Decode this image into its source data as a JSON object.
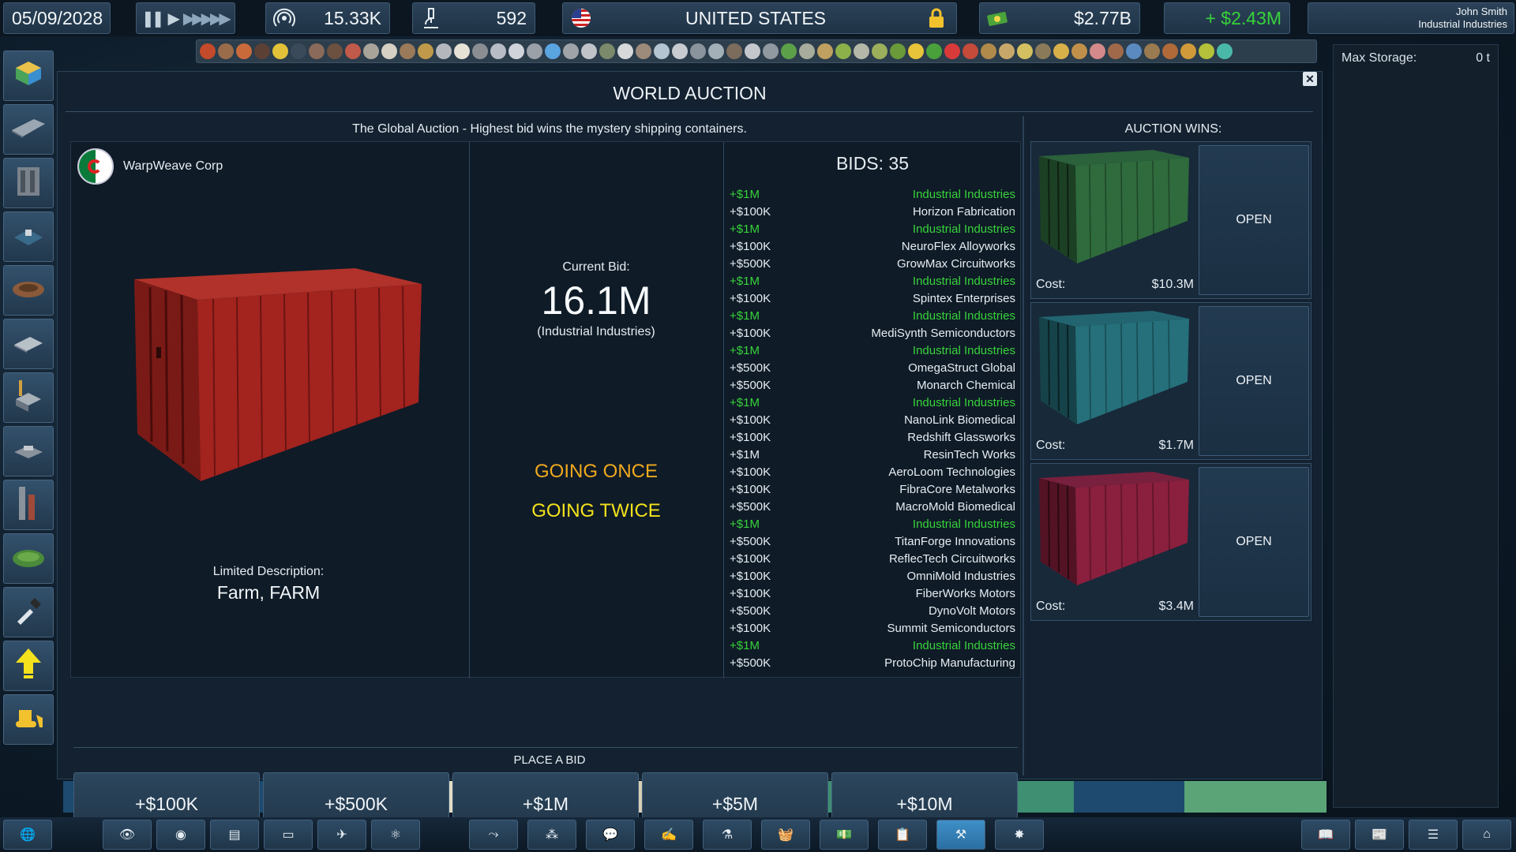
{
  "topbar": {
    "date": "05/09/2028",
    "speed_label": "game-speed-controls",
    "influence": "15.33K",
    "research": "592",
    "country": "UNITED STATES",
    "cash": "$2.77B",
    "income": "+ $2.43M",
    "user_name": "John Smith",
    "user_company": "Industrial Industries"
  },
  "right_panel": {
    "max_storage_label": "Max Storage:",
    "max_storage_value": "0 t"
  },
  "auction": {
    "title": "WORLD AUCTION",
    "subtitle": "The Global Auction - Highest bid wins the mystery shipping containers.",
    "company": "WarpWeave Corp",
    "desc_label": "Limited Description:",
    "desc_value": "Farm, FARM",
    "current_bid_label": "Current Bid:",
    "current_bid_value": "16.1M",
    "current_bidder": "(Industrial Industries)",
    "going_once": "GOING ONCE",
    "going_twice": "GOING TWICE",
    "bids_title": "BIDS:  35",
    "bids": [
      {
        "amount": "+$1M",
        "bidder": "Industrial Industries",
        "own": true
      },
      {
        "amount": "+$100K",
        "bidder": "Horizon Fabrication",
        "own": false
      },
      {
        "amount": "+$1M",
        "bidder": "Industrial Industries",
        "own": true
      },
      {
        "amount": "+$100K",
        "bidder": "NeuroFlex Alloyworks",
        "own": false
      },
      {
        "amount": "+$500K",
        "bidder": "GrowMax Circuitworks",
        "own": false
      },
      {
        "amount": "+$1M",
        "bidder": "Industrial Industries",
        "own": true
      },
      {
        "amount": "+$100K",
        "bidder": "Spintex Enterprises",
        "own": false
      },
      {
        "amount": "+$1M",
        "bidder": "Industrial Industries",
        "own": true
      },
      {
        "amount": "+$100K",
        "bidder": "MediSynth Semiconductors",
        "own": false
      },
      {
        "amount": "+$1M",
        "bidder": "Industrial Industries",
        "own": true
      },
      {
        "amount": "+$500K",
        "bidder": "OmegaStruct Global",
        "own": false
      },
      {
        "amount": "+$500K",
        "bidder": "Monarch Chemical",
        "own": false
      },
      {
        "amount": "+$1M",
        "bidder": "Industrial Industries",
        "own": true
      },
      {
        "amount": "+$100K",
        "bidder": "NanoLink Biomedical",
        "own": false
      },
      {
        "amount": "+$100K",
        "bidder": "Redshift Glassworks",
        "own": false
      },
      {
        "amount": "+$1M",
        "bidder": "ResinTech Works",
        "own": false
      },
      {
        "amount": "+$100K",
        "bidder": "AeroLoom Technologies",
        "own": false
      },
      {
        "amount": "+$100K",
        "bidder": "FibraCore Metalworks",
        "own": false
      },
      {
        "amount": "+$500K",
        "bidder": "MacroMold Biomedical",
        "own": false
      },
      {
        "amount": "+$1M",
        "bidder": "Industrial Industries",
        "own": true
      },
      {
        "amount": "+$500K",
        "bidder": "TitanForge Innovations",
        "own": false
      },
      {
        "amount": "+$100K",
        "bidder": "ReflecTech Circuitworks",
        "own": false
      },
      {
        "amount": "+$100K",
        "bidder": "OmniMold Industries",
        "own": false
      },
      {
        "amount": "+$100K",
        "bidder": "FiberWorks Motors",
        "own": false
      },
      {
        "amount": "+$500K",
        "bidder": "DynoVolt Motors",
        "own": false
      },
      {
        "amount": "+$100K",
        "bidder": "Summit Semiconductors",
        "own": false
      },
      {
        "amount": "+$1M",
        "bidder": "Industrial Industries",
        "own": true
      },
      {
        "amount": "+$500K",
        "bidder": "ProtoChip Manufacturing",
        "own": false
      }
    ],
    "place_bid_label": "PLACE A BID",
    "bid_buttons": [
      "+$100K",
      "+$500K",
      "+$1M",
      "+$5M",
      "+$10M"
    ],
    "wins_title": "AUCTION WINS:",
    "cost_label": "Cost:",
    "open_label": "OPEN",
    "wins": [
      {
        "cost": "$10.3M",
        "color": "#2f6b3c"
      },
      {
        "cost": "$1.7M",
        "color": "#25707a"
      },
      {
        "cost": "$3.4M",
        "color": "#8a1f3e"
      }
    ]
  },
  "colors": {
    "accent_green": "#37d33a",
    "going_once": "#f0a91e",
    "going_twice": "#f4e21c",
    "container_main": "#a3231f"
  }
}
